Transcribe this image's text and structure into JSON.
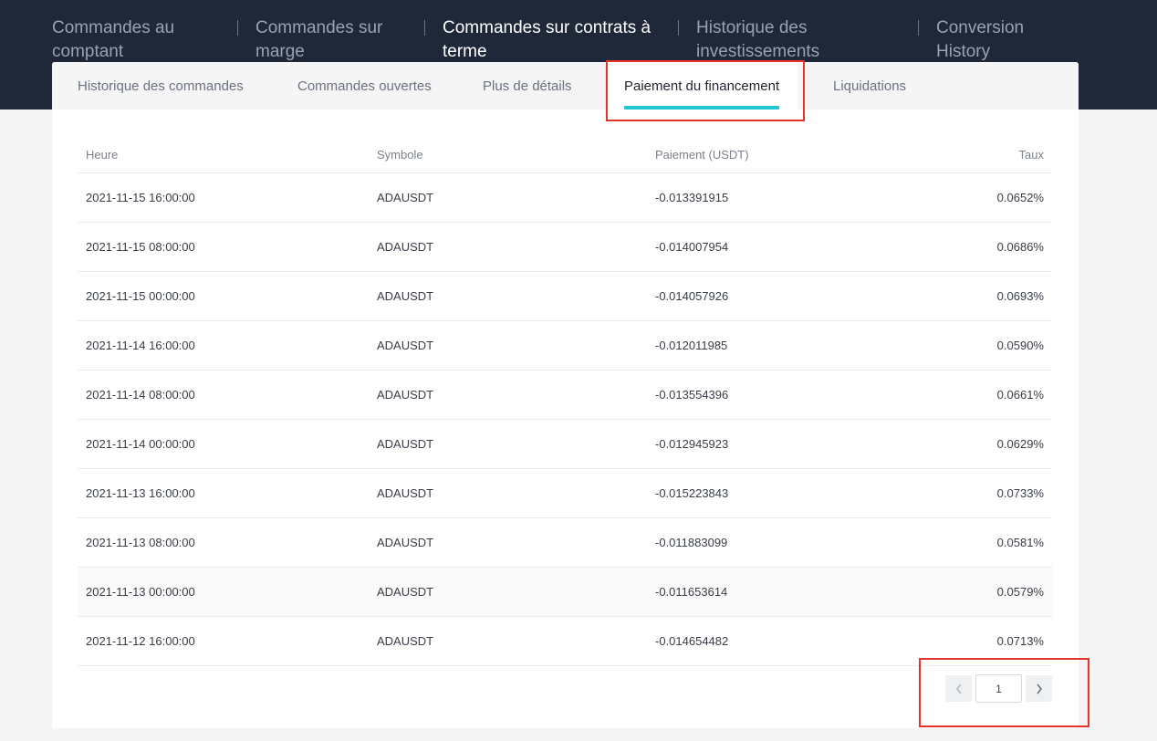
{
  "main_tabs": [
    {
      "label1": "Commandes au",
      "label2": "comptant"
    },
    {
      "label1": "Commandes sur",
      "label2": "marge"
    },
    {
      "label1": "Commandes sur contrats à",
      "label2": "terme"
    },
    {
      "label1": "Historique des",
      "label2": "investissements"
    },
    {
      "label1": "Conversion",
      "label2": "History"
    }
  ],
  "sub_tabs": [
    "Historique des commandes",
    "Commandes ouvertes",
    "Plus de détails",
    "Paiement du financement",
    "Liquidations"
  ],
  "table": {
    "columns": {
      "time": "Heure",
      "symbol": "Symbole",
      "payment": "Paiement (USDT)",
      "rate": "Taux"
    },
    "rows": [
      {
        "time": "2021-11-15 16:00:00",
        "symbol": "ADAUSDT",
        "payment": "-0.013391915",
        "rate": "0.0652%"
      },
      {
        "time": "2021-11-15 08:00:00",
        "symbol": "ADAUSDT",
        "payment": "-0.014007954",
        "rate": "0.0686%"
      },
      {
        "time": "2021-11-15 00:00:00",
        "symbol": "ADAUSDT",
        "payment": "-0.014057926",
        "rate": "0.0693%"
      },
      {
        "time": "2021-11-14 16:00:00",
        "symbol": "ADAUSDT",
        "payment": "-0.012011985",
        "rate": "0.0590%"
      },
      {
        "time": "2021-11-14 08:00:00",
        "symbol": "ADAUSDT",
        "payment": "-0.013554396",
        "rate": "0.0661%"
      },
      {
        "time": "2021-11-14 00:00:00",
        "symbol": "ADAUSDT",
        "payment": "-0.012945923",
        "rate": "0.0629%"
      },
      {
        "time": "2021-11-13 16:00:00",
        "symbol": "ADAUSDT",
        "payment": "-0.015223843",
        "rate": "0.0733%"
      },
      {
        "time": "2021-11-13 08:00:00",
        "symbol": "ADAUSDT",
        "payment": "-0.011883099",
        "rate": "0.0581%"
      },
      {
        "time": "2021-11-13 00:00:00",
        "symbol": "ADAUSDT",
        "payment": "-0.011653614",
        "rate": "0.0579%"
      },
      {
        "time": "2021-11-12 16:00:00",
        "symbol": "ADAUSDT",
        "payment": "-0.014654482",
        "rate": "0.0713%"
      }
    ]
  },
  "pagination": {
    "current_page": "1",
    "prev_icon": "chevron-left-icon",
    "next_icon": "chevron-right-icon"
  },
  "colors": {
    "header_bg": "#1f2838",
    "accent": "#1fc7d4",
    "highlight": "#e5322d"
  }
}
